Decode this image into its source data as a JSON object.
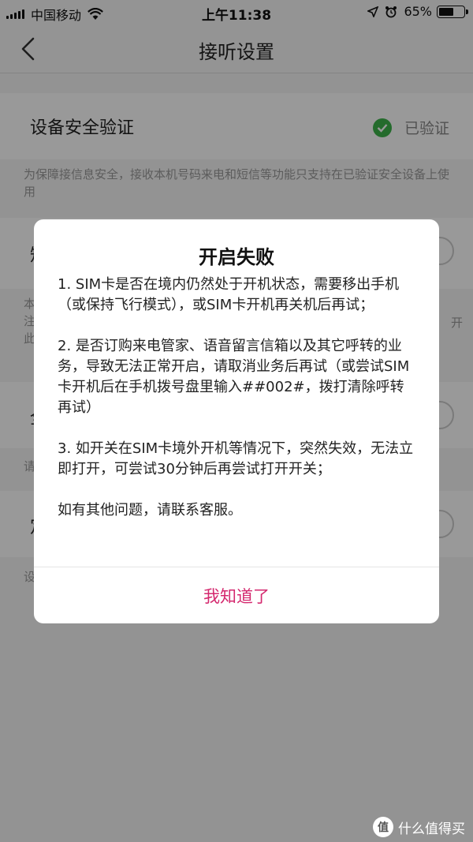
{
  "status_bar": {
    "carrier": "中国移动",
    "time": "上午11:38",
    "battery_percent": "65%",
    "battery_level": 0.65,
    "icons": [
      "signal-icon",
      "wifi-icon",
      "location-icon",
      "alarm-icon",
      "battery-icon"
    ]
  },
  "nav": {
    "title": "接听设置",
    "back_icon": "chevron-left-icon"
  },
  "settings": {
    "device_verify": {
      "title": "设备安全验证",
      "status": "已验证",
      "status_icon": "check-circle-icon",
      "status_color": "#3cb34a",
      "hint": "为保障接信息安全，接收本机号码来电和短信等功能只支持在已验证安全设备上使用"
    },
    "row2": {
      "title": "短",
      "hint": "本注此"
    },
    "row3": {
      "title": "全",
      "hint": "请"
    },
    "row4": {
      "title": "定",
      "hint": "设"
    },
    "hidden_right_char": "开"
  },
  "dialog": {
    "title": "开启失败",
    "items": [
      "1. SIM卡是否在境内仍然处于开机状态，需要移出手机（或保持飞行模式），或SIM卡开机再关机后再试；",
      "2. 是否订购来电管家、语音留言信箱以及其它呼转的业务，导致无法正常开启，请取消业务后再试（或尝试SIM卡开机后在手机拨号盘里输入##002#，拨打清除呼转再试）",
      "3. 如开关在SIM卡境外开机等情况下，突然失效，无法立即打开，可尝试30分钟后再尝试打开开关；",
      "如有其他问题，请联系客服。"
    ],
    "confirm_label": "我知道了",
    "accent_color": "#d4286e"
  },
  "watermark": {
    "logo_text": "值",
    "text": "什么值得买"
  }
}
